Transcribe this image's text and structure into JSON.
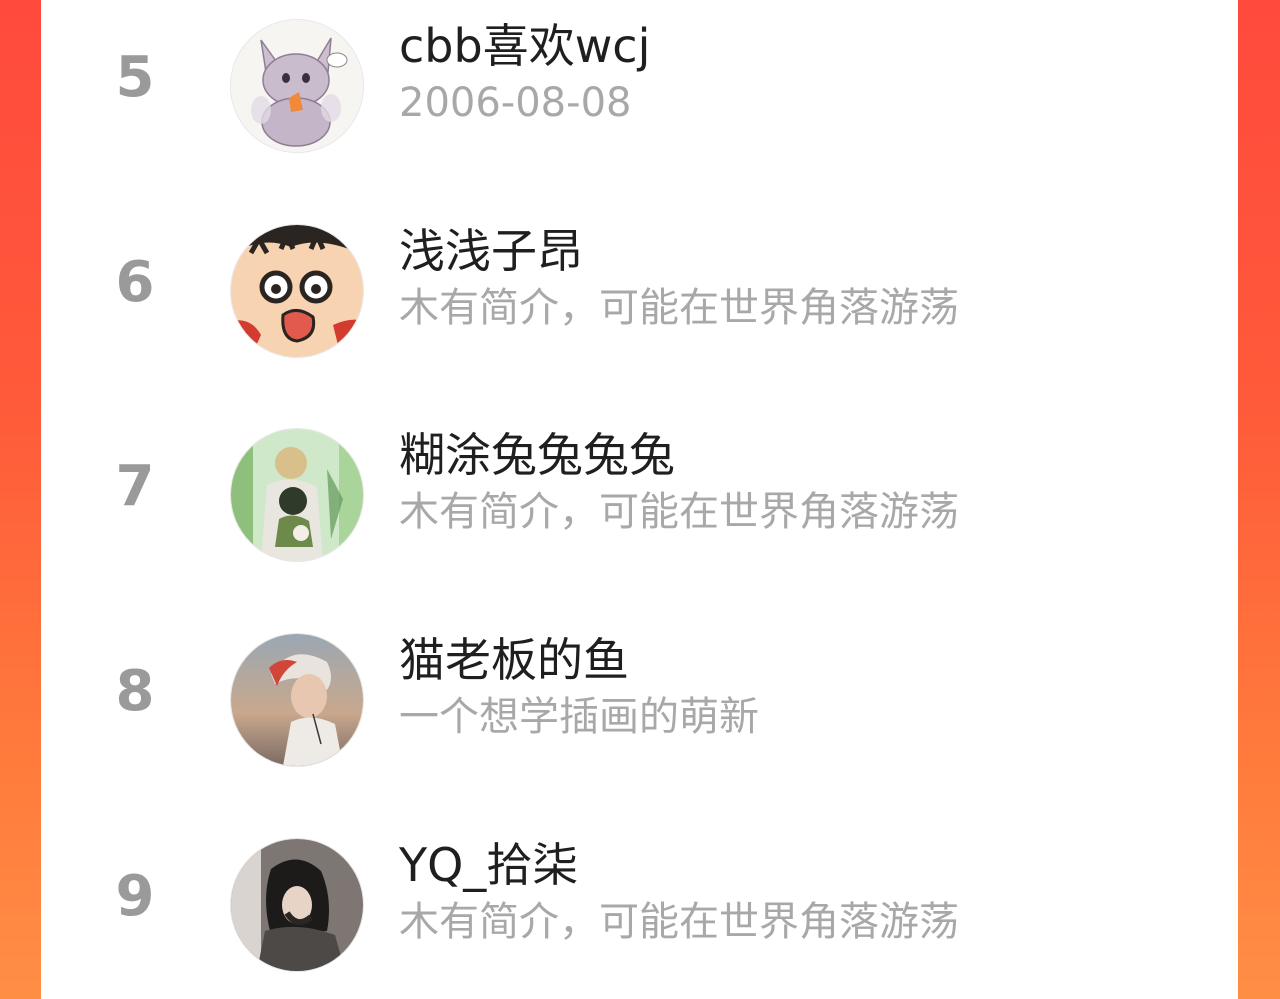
{
  "colors": {
    "frame_top": "#ff4a3d",
    "frame_bottom": "#ff8e45",
    "panel": "#ffffff",
    "rank_text": "#9a9a9a",
    "name_text": "#1f1f1f",
    "desc_text": "#a8a8a8"
  },
  "rankings": [
    {
      "rank": "5",
      "name": "cbb喜欢wcj",
      "desc": "2006-08-08",
      "avatar_icon": "cartoon-cat-avatar"
    },
    {
      "rank": "6",
      "name": "浅浅子昂",
      "desc": "木有简介，可能在世界角落游荡",
      "avatar_icon": "crayon-shinchan-avatar"
    },
    {
      "rank": "7",
      "name": "糊涂兔兔兔兔",
      "desc": "木有简介，可能在世界角落游荡",
      "avatar_icon": "anime-couple-forest-avatar"
    },
    {
      "rank": "8",
      "name": "猫老板的鱼",
      "desc": "一个想学插画的萌新",
      "avatar_icon": "red-hair-boy-avatar"
    },
    {
      "rank": "9",
      "name": "YQ_拾柒",
      "desc": "木有简介，可能在世界角落游荡",
      "avatar_icon": "dark-hair-girl-avatar"
    }
  ]
}
